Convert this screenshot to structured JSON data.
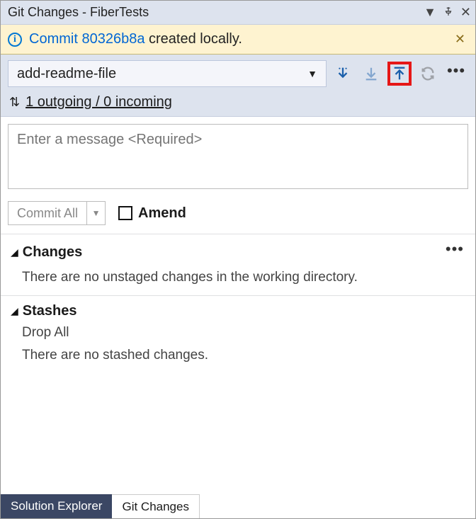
{
  "titlebar": {
    "title": "Git Changes - FiberTests"
  },
  "notice": {
    "prefix": "Commit ",
    "hash": "80326b8a",
    "suffix": " created locally."
  },
  "branch": {
    "name": "add-readme-file",
    "sync_text": "1 outgoing / 0 incoming"
  },
  "commit": {
    "placeholder": "Enter a message <Required>",
    "button_label": "Commit All",
    "amend_label": "Amend"
  },
  "changes": {
    "title": "Changes",
    "empty_text": "There are no unstaged changes in the working directory."
  },
  "stashes": {
    "title": "Stashes",
    "drop_all": "Drop All",
    "empty_text": "There are no stashed changes."
  },
  "tabs": {
    "solution_explorer": "Solution Explorer",
    "git_changes": "Git Changes"
  }
}
